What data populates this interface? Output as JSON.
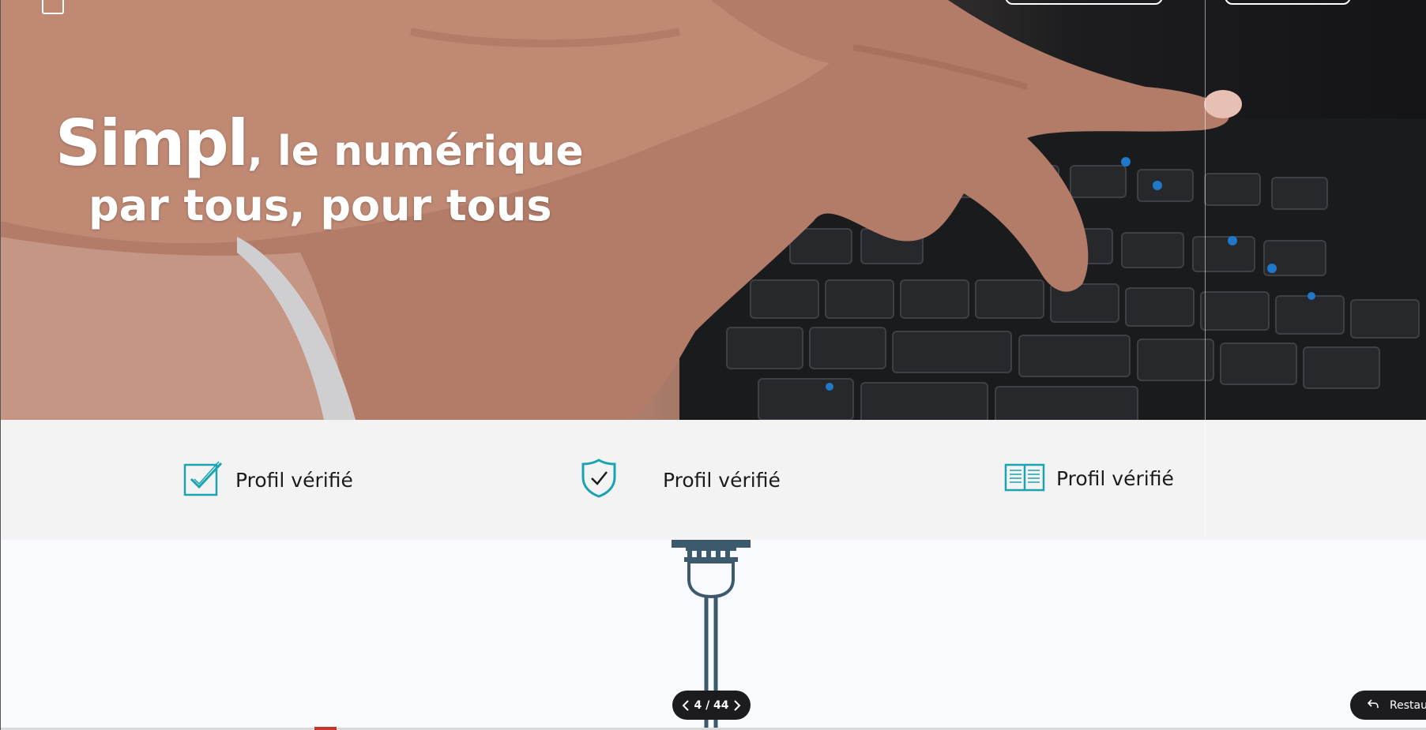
{
  "hero": {
    "headline_brand": "Simpl",
    "headline_rest": ", le numérique",
    "headline_line2": "par tous, pour tous"
  },
  "features": [
    {
      "icon": "checkbox-check-icon",
      "label": "Profil vérifié"
    },
    {
      "icon": "shield-check-icon",
      "label": "Profil vérifié"
    },
    {
      "icon": "open-book-icon",
      "label": "Profil vérifié"
    }
  ],
  "pager": {
    "text": "4 / 44"
  },
  "restore": {
    "label": "Restaurer"
  },
  "colors": {
    "accent_teal": "#1aa3b0",
    "illustration_slate": "#3c5a6b",
    "pill_dark": "#1c1c1e",
    "band_gray": "#f3f3f3"
  }
}
